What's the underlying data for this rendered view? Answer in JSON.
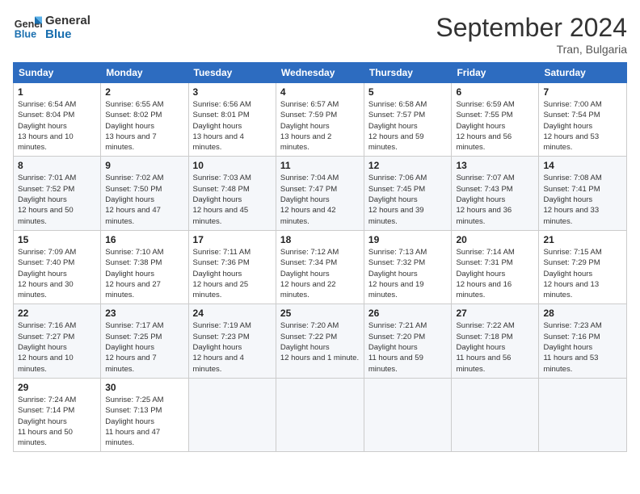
{
  "logo": {
    "line1": "General",
    "line2": "Blue"
  },
  "title": "September 2024",
  "location": "Tran, Bulgaria",
  "days_of_week": [
    "Sunday",
    "Monday",
    "Tuesday",
    "Wednesday",
    "Thursday",
    "Friday",
    "Saturday"
  ],
  "weeks": [
    [
      {
        "day": 1,
        "sunrise": "6:54 AM",
        "sunset": "8:04 PM",
        "daylight": "13 hours and 10 minutes."
      },
      {
        "day": 2,
        "sunrise": "6:55 AM",
        "sunset": "8:02 PM",
        "daylight": "13 hours and 7 minutes."
      },
      {
        "day": 3,
        "sunrise": "6:56 AM",
        "sunset": "8:01 PM",
        "daylight": "13 hours and 4 minutes."
      },
      {
        "day": 4,
        "sunrise": "6:57 AM",
        "sunset": "7:59 PM",
        "daylight": "13 hours and 2 minutes."
      },
      {
        "day": 5,
        "sunrise": "6:58 AM",
        "sunset": "7:57 PM",
        "daylight": "12 hours and 59 minutes."
      },
      {
        "day": 6,
        "sunrise": "6:59 AM",
        "sunset": "7:55 PM",
        "daylight": "12 hours and 56 minutes."
      },
      {
        "day": 7,
        "sunrise": "7:00 AM",
        "sunset": "7:54 PM",
        "daylight": "12 hours and 53 minutes."
      }
    ],
    [
      {
        "day": 8,
        "sunrise": "7:01 AM",
        "sunset": "7:52 PM",
        "daylight": "12 hours and 50 minutes."
      },
      {
        "day": 9,
        "sunrise": "7:02 AM",
        "sunset": "7:50 PM",
        "daylight": "12 hours and 47 minutes."
      },
      {
        "day": 10,
        "sunrise": "7:03 AM",
        "sunset": "7:48 PM",
        "daylight": "12 hours and 45 minutes."
      },
      {
        "day": 11,
        "sunrise": "7:04 AM",
        "sunset": "7:47 PM",
        "daylight": "12 hours and 42 minutes."
      },
      {
        "day": 12,
        "sunrise": "7:06 AM",
        "sunset": "7:45 PM",
        "daylight": "12 hours and 39 minutes."
      },
      {
        "day": 13,
        "sunrise": "7:07 AM",
        "sunset": "7:43 PM",
        "daylight": "12 hours and 36 minutes."
      },
      {
        "day": 14,
        "sunrise": "7:08 AM",
        "sunset": "7:41 PM",
        "daylight": "12 hours and 33 minutes."
      }
    ],
    [
      {
        "day": 15,
        "sunrise": "7:09 AM",
        "sunset": "7:40 PM",
        "daylight": "12 hours and 30 minutes."
      },
      {
        "day": 16,
        "sunrise": "7:10 AM",
        "sunset": "7:38 PM",
        "daylight": "12 hours and 27 minutes."
      },
      {
        "day": 17,
        "sunrise": "7:11 AM",
        "sunset": "7:36 PM",
        "daylight": "12 hours and 25 minutes."
      },
      {
        "day": 18,
        "sunrise": "7:12 AM",
        "sunset": "7:34 PM",
        "daylight": "12 hours and 22 minutes."
      },
      {
        "day": 19,
        "sunrise": "7:13 AM",
        "sunset": "7:32 PM",
        "daylight": "12 hours and 19 minutes."
      },
      {
        "day": 20,
        "sunrise": "7:14 AM",
        "sunset": "7:31 PM",
        "daylight": "12 hours and 16 minutes."
      },
      {
        "day": 21,
        "sunrise": "7:15 AM",
        "sunset": "7:29 PM",
        "daylight": "12 hours and 13 minutes."
      }
    ],
    [
      {
        "day": 22,
        "sunrise": "7:16 AM",
        "sunset": "7:27 PM",
        "daylight": "12 hours and 10 minutes."
      },
      {
        "day": 23,
        "sunrise": "7:17 AM",
        "sunset": "7:25 PM",
        "daylight": "12 hours and 7 minutes."
      },
      {
        "day": 24,
        "sunrise": "7:19 AM",
        "sunset": "7:23 PM",
        "daylight": "12 hours and 4 minutes."
      },
      {
        "day": 25,
        "sunrise": "7:20 AM",
        "sunset": "7:22 PM",
        "daylight": "12 hours and 1 minute."
      },
      {
        "day": 26,
        "sunrise": "7:21 AM",
        "sunset": "7:20 PM",
        "daylight": "11 hours and 59 minutes."
      },
      {
        "day": 27,
        "sunrise": "7:22 AM",
        "sunset": "7:18 PM",
        "daylight": "11 hours and 56 minutes."
      },
      {
        "day": 28,
        "sunrise": "7:23 AM",
        "sunset": "7:16 PM",
        "daylight": "11 hours and 53 minutes."
      }
    ],
    [
      {
        "day": 29,
        "sunrise": "7:24 AM",
        "sunset": "7:14 PM",
        "daylight": "11 hours and 50 minutes."
      },
      {
        "day": 30,
        "sunrise": "7:25 AM",
        "sunset": "7:13 PM",
        "daylight": "11 hours and 47 minutes."
      },
      null,
      null,
      null,
      null,
      null
    ]
  ]
}
